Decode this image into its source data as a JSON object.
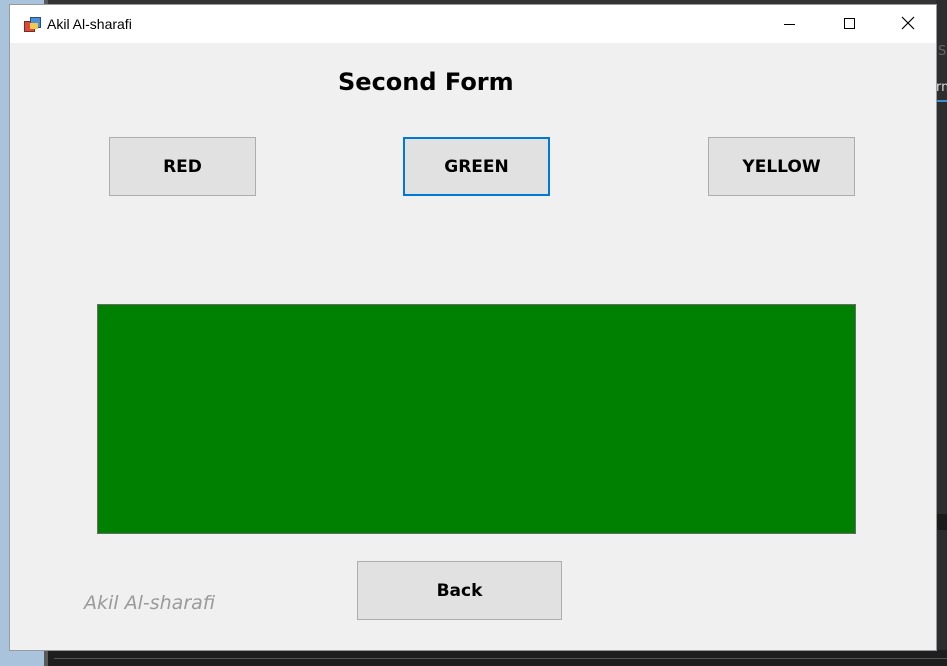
{
  "window": {
    "title": "Akil Al-sharafi",
    "icon": "windows-form-icon"
  },
  "caption_buttons": {
    "minimize_icon": "minimize-icon",
    "maximize_icon": "maximize-icon",
    "close_icon": "close-icon"
  },
  "form": {
    "heading": "Second Form",
    "buttons": {
      "red": "RED",
      "green": "GREEN",
      "yellow": "YELLOW",
      "back": "Back"
    },
    "panel_color": "#008000",
    "focused_button": "GREEN",
    "signature": "Akil Al-sharafi"
  },
  "background": {
    "frag1": "S",
    "frag2": "rm"
  },
  "colors": {
    "focus_border": "#0078d7",
    "panel": "#008000",
    "form_bg": "#f0f0f0"
  }
}
